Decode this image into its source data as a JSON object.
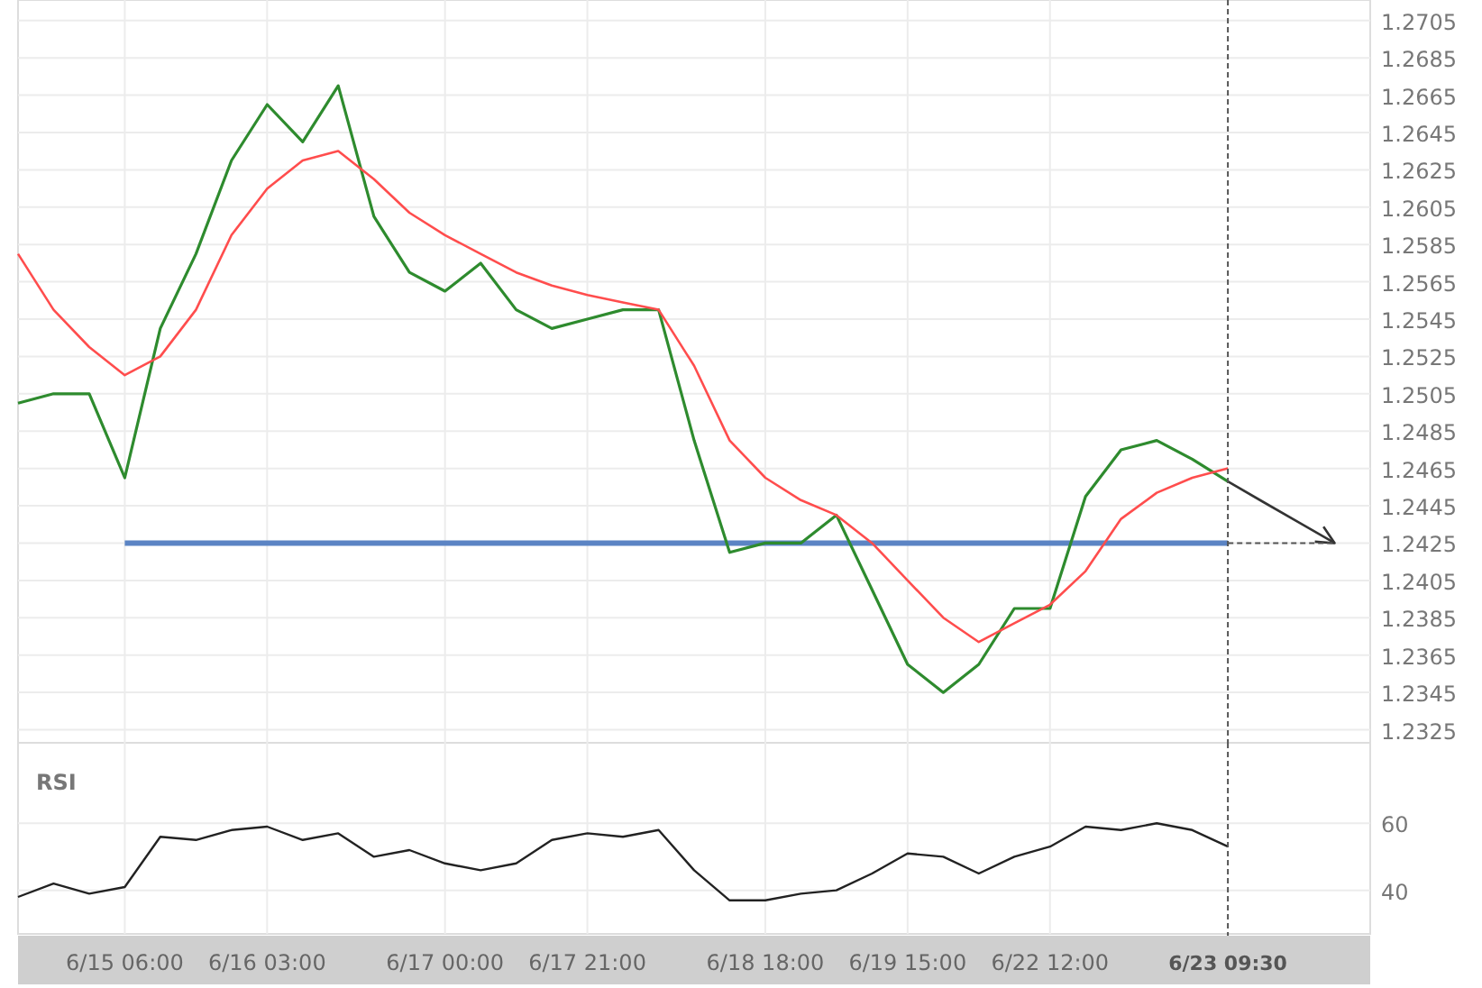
{
  "price_chart": {
    "chart_data": {
      "type": "line",
      "categories": [
        null,
        null,
        null,
        null,
        null,
        null,
        null,
        null,
        null,
        null,
        null,
        null,
        null,
        null,
        null,
        null,
        null,
        null,
        null,
        null,
        null,
        null,
        null,
        null,
        null,
        null,
        null,
        null,
        null,
        null,
        null,
        null,
        null,
        null,
        null,
        null,
        null,
        null
      ],
      "grid": true,
      "ylim": [
        1.2318,
        1.2716
      ],
      "yticks": [
        {
          "value": 1.2325,
          "label": "1.2325"
        },
        {
          "value": 1.2345,
          "label": "1.2345"
        },
        {
          "value": 1.2365,
          "label": "1.2365"
        },
        {
          "value": 1.2385,
          "label": "1.2385"
        },
        {
          "value": 1.2405,
          "label": "1.2405"
        },
        {
          "value": 1.2425,
          "label": "1.2425"
        },
        {
          "value": 1.2445,
          "label": "1.2445"
        },
        {
          "value": 1.2465,
          "label": "1.2465"
        },
        {
          "value": 1.2485,
          "label": "1.2485"
        },
        {
          "value": 1.2505,
          "label": "1.2505"
        },
        {
          "value": 1.2525,
          "label": "1.2525"
        },
        {
          "value": 1.2545,
          "label": "1.2545"
        },
        {
          "value": 1.2565,
          "label": "1.2565"
        },
        {
          "value": 1.2585,
          "label": "1.2585"
        },
        {
          "value": 1.2605,
          "label": "1.2605"
        },
        {
          "value": 1.2625,
          "label": "1.2625"
        },
        {
          "value": 1.2645,
          "label": "1.2645"
        },
        {
          "value": 1.2665,
          "label": "1.2665"
        },
        {
          "value": 1.2685,
          "label": "1.2685"
        },
        {
          "value": 1.2705,
          "label": "1.2705"
        }
      ],
      "series": [
        {
          "color": "#2e8b2e",
          "values": [
            1.25,
            1.2505,
            1.2505,
            1.246,
            1.254,
            1.258,
            1.263,
            1.266,
            1.264,
            1.267,
            1.26,
            1.257,
            1.256,
            1.2575,
            1.255,
            1.254,
            1.2545,
            1.255,
            1.255,
            1.248,
            1.242,
            1.2425,
            1.2425,
            1.244,
            1.24,
            1.236,
            1.2345,
            1.236,
            1.239,
            1.239,
            1.245,
            1.2475,
            1.248,
            1.247,
            1.2458,
            null,
            null,
            null
          ]
        },
        {
          "color": "#ff4d4d",
          "values": [
            1.258,
            1.255,
            1.253,
            1.2515,
            1.2525,
            1.255,
            1.259,
            1.2615,
            1.263,
            1.2635,
            1.262,
            1.2602,
            1.259,
            1.258,
            1.257,
            1.2563,
            1.2558,
            1.2554,
            1.255,
            1.252,
            1.248,
            1.246,
            1.2448,
            1.244,
            1.2425,
            1.2405,
            1.2385,
            1.2372,
            1.2382,
            1.2392,
            1.241,
            1.2438,
            1.2452,
            1.246,
            1.2465,
            null,
            null,
            null
          ]
        },
        {
          "color": "#333333",
          "values": [
            null,
            null,
            null,
            null,
            null,
            null,
            null,
            null,
            null,
            null,
            null,
            null,
            null,
            null,
            null,
            null,
            null,
            null,
            null,
            null,
            null,
            null,
            null,
            null,
            null,
            null,
            null,
            null,
            null,
            null,
            null,
            null,
            null,
            null,
            1.2458,
            1.2447,
            1.2436,
            1.2425
          ]
        },
        {
          "color": "#555555",
          "line_style": "dashed",
          "values": [
            null,
            null,
            null,
            null,
            null,
            null,
            null,
            null,
            null,
            null,
            null,
            null,
            null,
            null,
            null,
            null,
            null,
            null,
            null,
            null,
            null,
            null,
            null,
            null,
            null,
            null,
            null,
            null,
            null,
            null,
            null,
            null,
            null,
            null,
            1.2425,
            1.2425,
            1.2425,
            1.2425
          ]
        }
      ],
      "ref_lines": [
        {
          "axis": "y",
          "value": 1.2425,
          "color": "#5b84c4"
        }
      ]
    }
  },
  "rsi_panel": {
    "chart_data": {
      "type": "line",
      "title": "RSI",
      "categories": [
        null,
        null,
        null,
        "6/15 06:00",
        null,
        null,
        null,
        "6/16 03:00",
        null,
        null,
        null,
        null,
        "6/17 00:00",
        null,
        null,
        null,
        "6/17 21:00",
        null,
        null,
        null,
        null,
        "6/18 18:00",
        null,
        null,
        null,
        "6/19 15:00",
        null,
        null,
        null,
        "6/22 12:00",
        null,
        null,
        null,
        null,
        "6/23 09:30",
        null,
        null,
        null
      ],
      "grid": true,
      "ylim": [
        27,
        84
      ],
      "yticks": [
        {
          "value": 40,
          "label": "40"
        },
        {
          "value": 60,
          "label": "60"
        }
      ],
      "series": [
        {
          "color": "#222222",
          "values": [
            38,
            42,
            39,
            41,
            56,
            55,
            58,
            59,
            55,
            57,
            50,
            52,
            48,
            46,
            48,
            55,
            57,
            56,
            58,
            46,
            37,
            37,
            39,
            40,
            45,
            51,
            50,
            45,
            50,
            53,
            59,
            58,
            60,
            58,
            53,
            null,
            null,
            null
          ]
        }
      ]
    }
  }
}
